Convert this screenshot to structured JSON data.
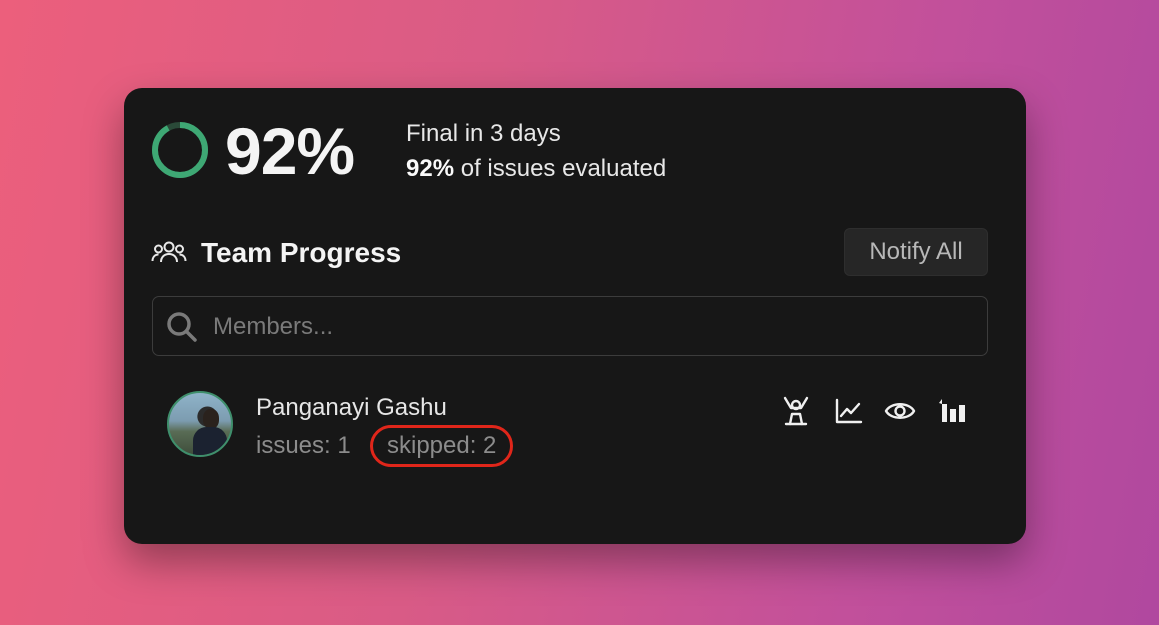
{
  "summary": {
    "percent_display": "92%",
    "progress_fraction": 0.92,
    "final_text": "Final in 3 days",
    "eval_percent": "92%",
    "eval_suffix": " of issues evaluated",
    "ring_color": "#3ea874"
  },
  "team": {
    "title": "Team Progress",
    "notify_label": "Notify All"
  },
  "search": {
    "placeholder": "Members...",
    "value": ""
  },
  "members": [
    {
      "name": "Panganayi Gashu",
      "issues_text": "issues: 1",
      "skipped_text": "skipped: 2",
      "actions": [
        "reviewer-icon",
        "chart-icon",
        "eye-icon",
        "ranking-icon"
      ]
    }
  ],
  "colors": {
    "card_bg": "#171717",
    "highlight": "#e0261a"
  }
}
